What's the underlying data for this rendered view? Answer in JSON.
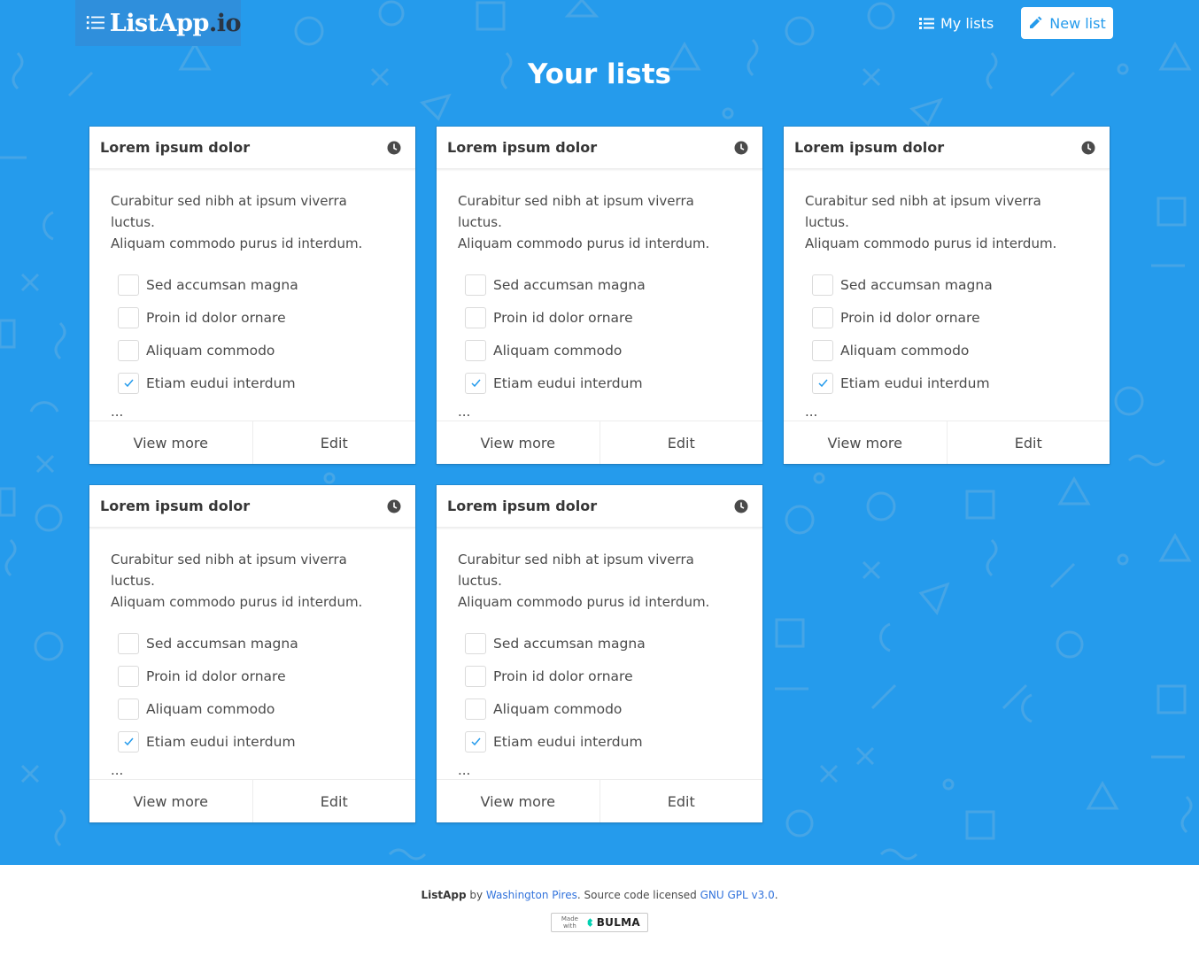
{
  "brand": {
    "name": "ListApp",
    "suffix": ".io"
  },
  "nav": {
    "my_lists": "My lists",
    "new_list": "New list"
  },
  "page_title": "Your lists",
  "colors": {
    "hero_bg": "#259bec",
    "accent": "#259bec",
    "brand_bg": "#2f8fdc"
  },
  "lists": [
    {
      "title": "Lorem ipsum dolor",
      "desc_line1": "Curabitur sed nibh at ipsum viverra luctus.",
      "desc_line2": "Aliquam commodo purus id interdum.",
      "items": [
        {
          "label": "Sed accumsan magna",
          "checked": false
        },
        {
          "label": "Proin id dolor ornare",
          "checked": false
        },
        {
          "label": "Aliquam commodo",
          "checked": false
        },
        {
          "label": "Etiam eudui interdum",
          "checked": true
        }
      ],
      "more": "...",
      "view_more": "View more",
      "edit": "Edit"
    },
    {
      "title": "Lorem ipsum dolor",
      "desc_line1": "Curabitur sed nibh at ipsum viverra luctus.",
      "desc_line2": "Aliquam commodo purus id interdum.",
      "items": [
        {
          "label": "Sed accumsan magna",
          "checked": false
        },
        {
          "label": "Proin id dolor ornare",
          "checked": false
        },
        {
          "label": "Aliquam commodo",
          "checked": false
        },
        {
          "label": "Etiam eudui interdum",
          "checked": true
        }
      ],
      "more": "...",
      "view_more": "View more",
      "edit": "Edit"
    },
    {
      "title": "Lorem ipsum dolor",
      "desc_line1": "Curabitur sed nibh at ipsum viverra luctus.",
      "desc_line2": "Aliquam commodo purus id interdum.",
      "items": [
        {
          "label": "Sed accumsan magna",
          "checked": false
        },
        {
          "label": "Proin id dolor ornare",
          "checked": false
        },
        {
          "label": "Aliquam commodo",
          "checked": false
        },
        {
          "label": "Etiam eudui interdum",
          "checked": true
        }
      ],
      "more": "...",
      "view_more": "View more",
      "edit": "Edit"
    },
    {
      "title": "Lorem ipsum dolor",
      "desc_line1": "Curabitur sed nibh at ipsum viverra luctus.",
      "desc_line2": "Aliquam commodo purus id interdum.",
      "items": [
        {
          "label": "Sed accumsan magna",
          "checked": false
        },
        {
          "label": "Proin id dolor ornare",
          "checked": false
        },
        {
          "label": "Aliquam commodo",
          "checked": false
        },
        {
          "label": "Etiam eudui interdum",
          "checked": true
        }
      ],
      "more": "...",
      "view_more": "View more",
      "edit": "Edit"
    },
    {
      "title": "Lorem ipsum dolor",
      "desc_line1": "Curabitur sed nibh at ipsum viverra luctus.",
      "desc_line2": "Aliquam commodo purus id interdum.",
      "items": [
        {
          "label": "Sed accumsan magna",
          "checked": false
        },
        {
          "label": "Proin id dolor ornare",
          "checked": false
        },
        {
          "label": "Aliquam commodo",
          "checked": false
        },
        {
          "label": "Etiam eudui interdum",
          "checked": true
        }
      ],
      "more": "...",
      "view_more": "View more",
      "edit": "Edit"
    }
  ],
  "footer": {
    "app": "ListApp",
    "by": " by ",
    "author": "Washington Pires",
    "mid": ". Source code licensed ",
    "license": "GNU GPL v3.0",
    "end": ".",
    "badge_made": "Made with",
    "badge_word": "BULMA"
  }
}
